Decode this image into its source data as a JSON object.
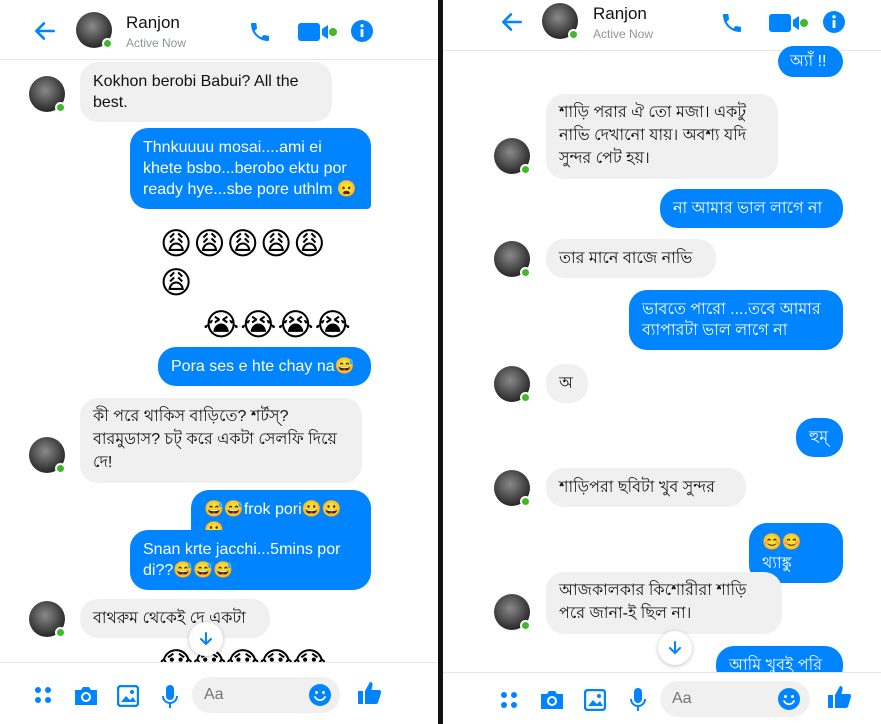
{
  "contact": {
    "name": "Ranjon",
    "status": "Active Now"
  },
  "colors": {
    "accent": "#0084ff",
    "incoming_bg": "#f1f0f0",
    "online": "#42b72a"
  },
  "composer": {
    "placeholder": "Aa"
  },
  "left": {
    "messages": [
      {
        "dir": "in",
        "text": "Kokhon berobi Babui? All the best."
      },
      {
        "dir": "out",
        "text": "Thnkuuuu mosai....ami ei khete bsbo...berobo ektu por ready hye...sbe pore uthlm 😦"
      },
      {
        "dir": "emoji",
        "text": "😩😩😩😩😩"
      },
      {
        "dir": "emoji",
        "text": "😩"
      },
      {
        "dir": "emoji",
        "text": "😭😭😭😭"
      },
      {
        "dir": "out",
        "text": "Pora ses e hte chay na😅"
      },
      {
        "dir": "in",
        "text": "কী পরে থাকিস বাড়িতে? শর্টস্? বারমুডাস? চট্ করে একটা সেলফি দিয়ে দে!"
      },
      {
        "dir": "out",
        "text": "😅😅frok pori😀😀😀"
      },
      {
        "dir": "out",
        "text": "Snan krte jacchi...5mins por di??😅😅😅"
      },
      {
        "dir": "in",
        "text": "বাথরুম থেকেই দে একটা"
      },
      {
        "dir": "emoji",
        "text": "😱😱😱😱😱"
      }
    ]
  },
  "right": {
    "messages": [
      {
        "dir": "out",
        "text": "অ্যাঁ !!"
      },
      {
        "dir": "in",
        "text": "শাড়ি পরার ঐ তো মজা। একটু নাভি দেখানো যায়। অবশ্য যদি সুন্দর পেট হয়।"
      },
      {
        "dir": "out",
        "text": "না আমার ভাল লাগে না"
      },
      {
        "dir": "in",
        "text": "তার মানে বাজে নাভি"
      },
      {
        "dir": "out",
        "text": "ভাবতে পারো ....তবে আমার ব্যাপারটা ভাল লাগে না"
      },
      {
        "dir": "in",
        "text": "অ"
      },
      {
        "dir": "out",
        "text": "হুম্"
      },
      {
        "dir": "in",
        "text": "শাড়িপরা ছবিটা খুব সুন্দর"
      },
      {
        "dir": "out",
        "text": "😊😊থ্যাঙ্কু"
      },
      {
        "dir": "in",
        "text": "আজকালকার কিশোরীরা শাড়ি পরে জানা-ই ছিল না।"
      },
      {
        "dir": "out",
        "text": "আমি খুবই পরি"
      }
    ]
  }
}
